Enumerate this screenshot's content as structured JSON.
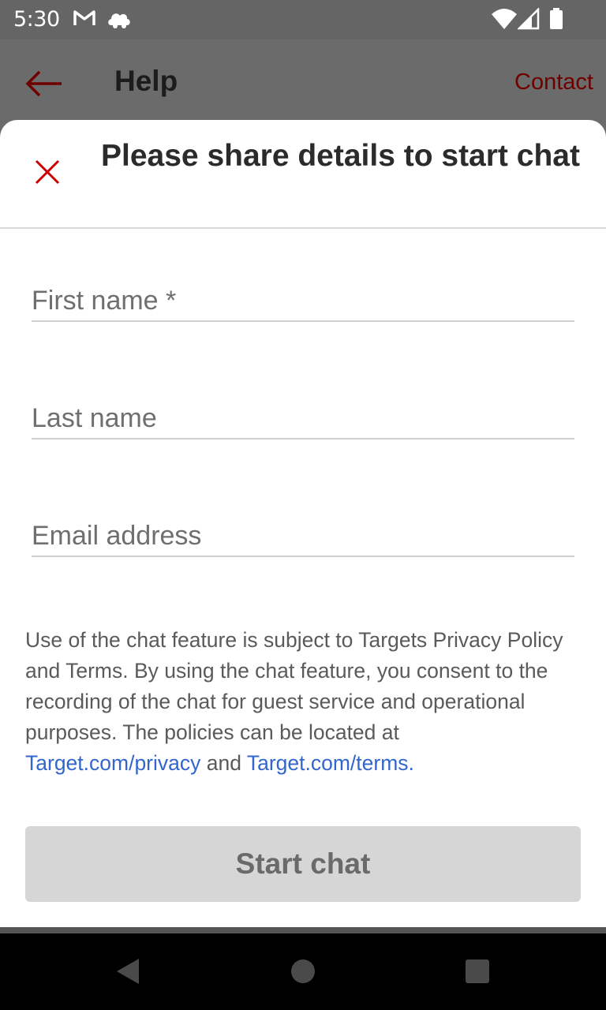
{
  "status_bar": {
    "time": "5:30",
    "icons": [
      "gmail-icon",
      "cloud-icon",
      "wifi-icon",
      "cell-signal-icon",
      "battery-icon"
    ]
  },
  "app_bar": {
    "title": "Help",
    "action_label": "Contact",
    "back_icon": "back-arrow-icon"
  },
  "sheet": {
    "title": "Please share details to start chat",
    "close_icon": "close-icon",
    "fields": {
      "first_name_placeholder": "First name *",
      "last_name_placeholder": "Last name",
      "email_placeholder": "Email address",
      "first_name_value": "",
      "last_name_value": "",
      "email_value": ""
    },
    "disclaimer": {
      "text": "Use of the chat feature is subject to Targets Privacy Policy and Terms. By using the chat feature, you consent to the recording of the chat for guest service and operational purposes. The policies can be located at ",
      "privacy_link": "Target.com/privacy",
      "joiner": " and ",
      "terms_link": "Target.com/terms."
    },
    "start_button": "Start chat"
  },
  "nav_bar": {
    "icons": [
      "back-triangle-icon",
      "home-circle-icon",
      "recents-square-icon"
    ]
  },
  "colors": {
    "brand_red": "#cc0000",
    "link_blue": "#3366cc",
    "disabled_button": "#d6d6d6"
  }
}
